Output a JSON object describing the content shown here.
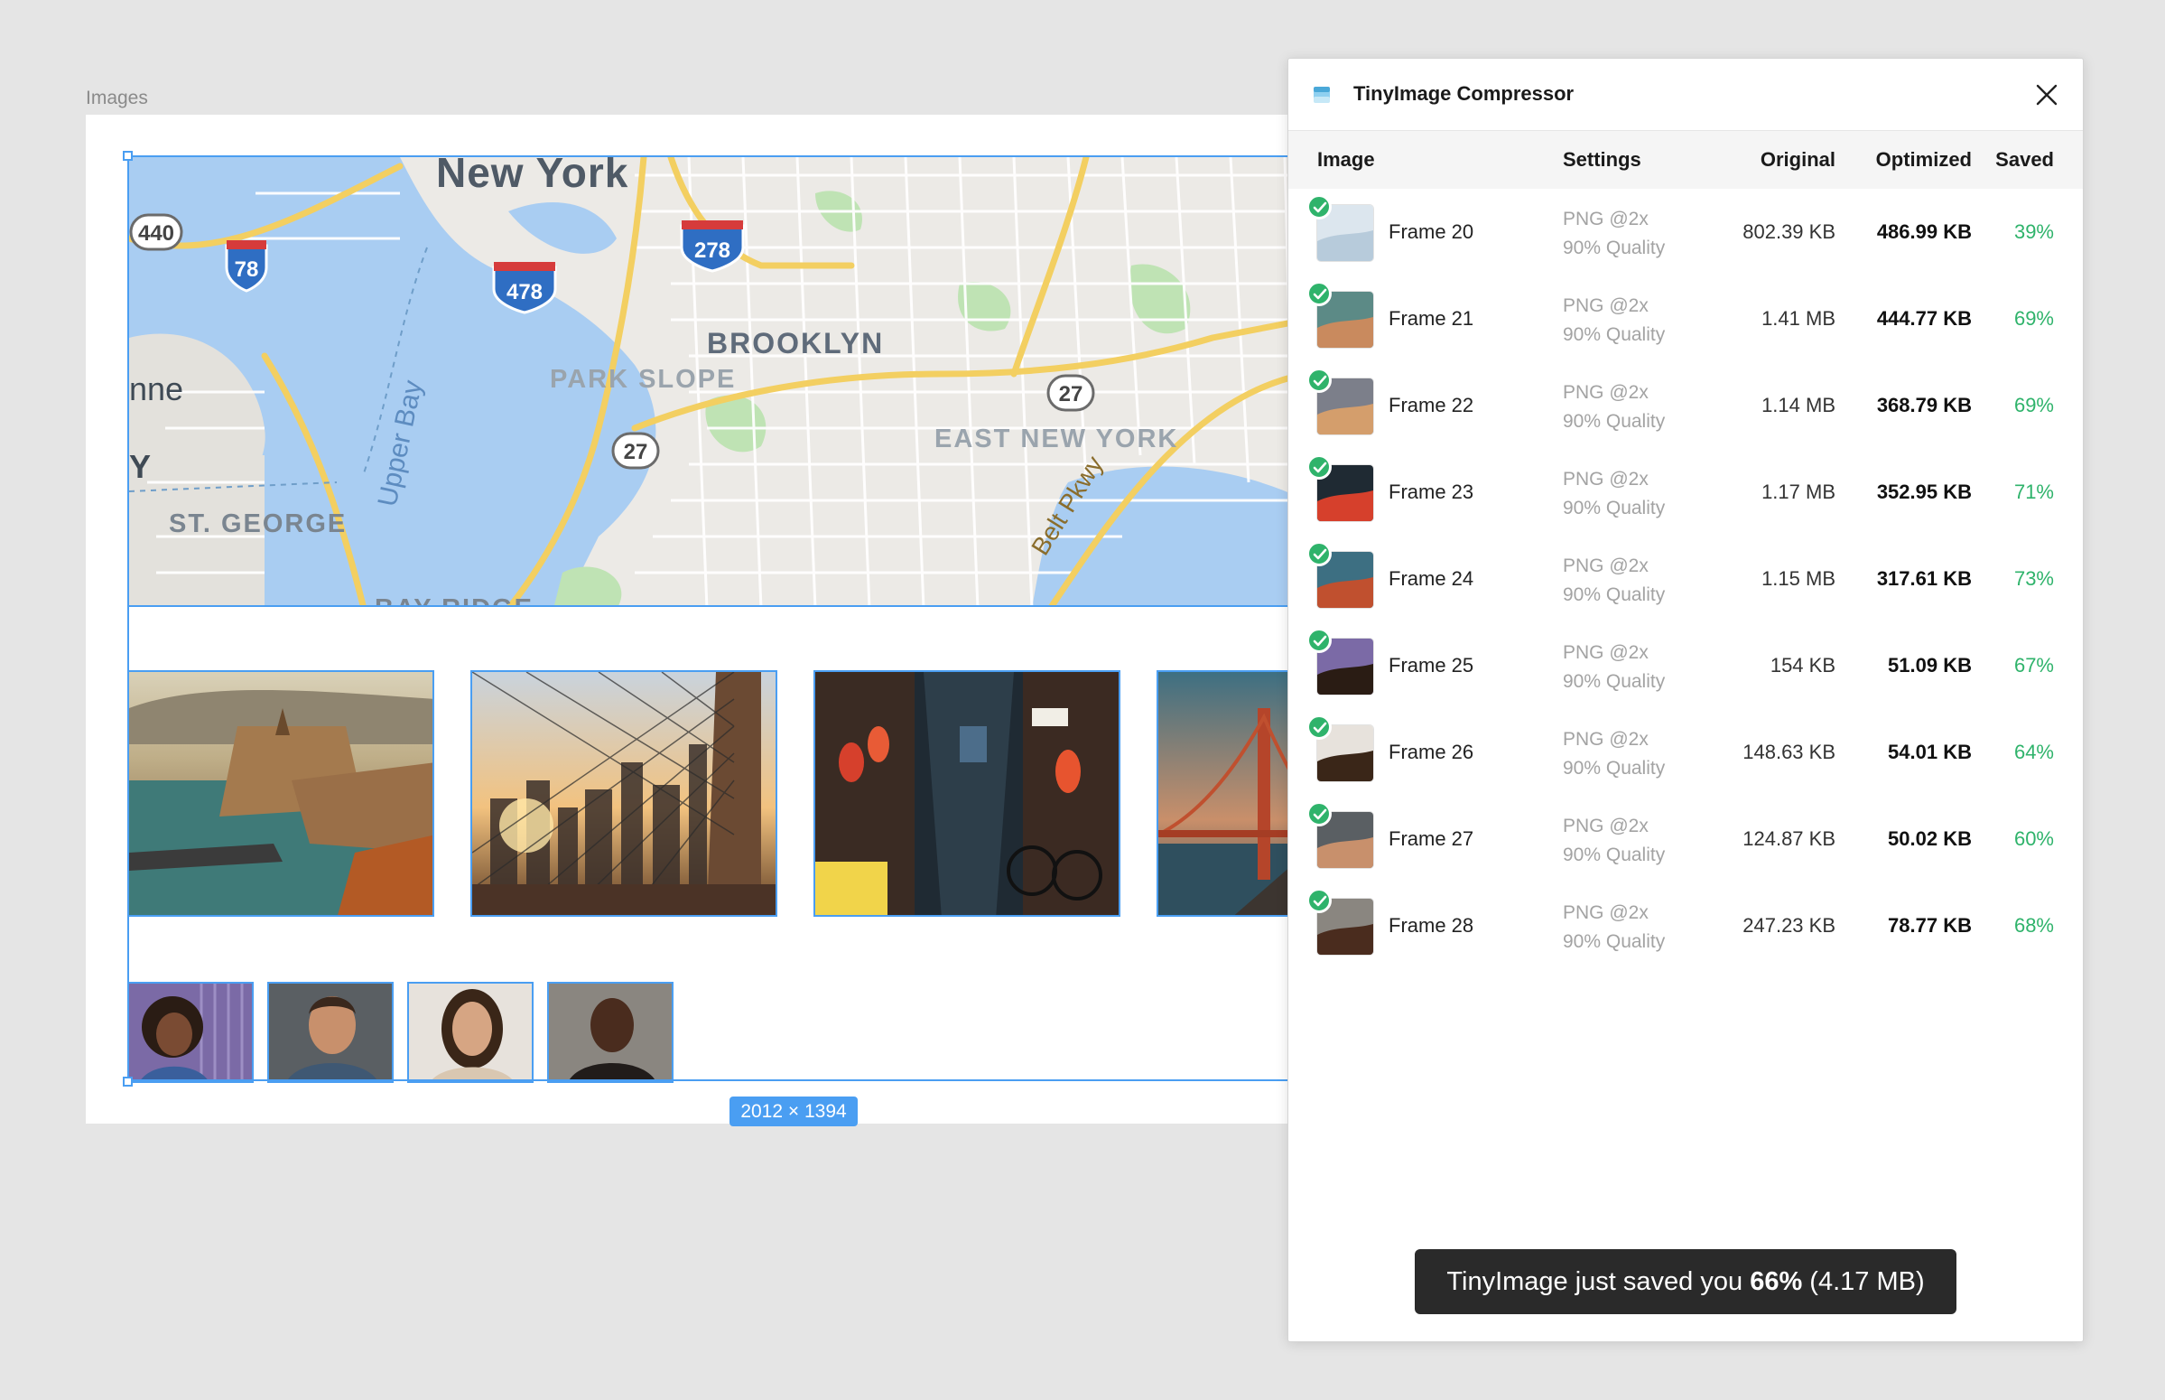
{
  "canvas": {
    "frame_label": "Images",
    "selection_size": "2012 × 1394",
    "map_labels": [
      "New York",
      "BROOKLYN",
      "PARK SLOPE",
      "EAST NEW YORK",
      "ST. GEORGE",
      "BAY RIDGE",
      "Upper Bay",
      "Belt Pkwy",
      "nne",
      "Y"
    ],
    "highway_shields": [
      "440",
      "78",
      "478",
      "278",
      "27",
      "27"
    ]
  },
  "panel": {
    "title": "TinyImage Compressor",
    "columns": {
      "image": "Image",
      "settings": "Settings",
      "original": "Original",
      "optimized": "Optimized",
      "saved": "Saved"
    },
    "rows": [
      {
        "name": "Frame 20",
        "format": "PNG @2x",
        "quality": "90% Quality",
        "original": "802.39 KB",
        "optimized": "486.99 KB",
        "saved": "39%"
      },
      {
        "name": "Frame 21",
        "format": "PNG @2x",
        "quality": "90% Quality",
        "original": "1.41 MB",
        "optimized": "444.77 KB",
        "saved": "69%"
      },
      {
        "name": "Frame 22",
        "format": "PNG @2x",
        "quality": "90% Quality",
        "original": "1.14 MB",
        "optimized": "368.79 KB",
        "saved": "69%"
      },
      {
        "name": "Frame 23",
        "format": "PNG @2x",
        "quality": "90% Quality",
        "original": "1.17 MB",
        "optimized": "352.95 KB",
        "saved": "71%"
      },
      {
        "name": "Frame 24",
        "format": "PNG @2x",
        "quality": "90% Quality",
        "original": "1.15 MB",
        "optimized": "317.61 KB",
        "saved": "73%"
      },
      {
        "name": "Frame 25",
        "format": "PNG @2x",
        "quality": "90% Quality",
        "original": "154 KB",
        "optimized": "51.09 KB",
        "saved": "67%"
      },
      {
        "name": "Frame 26",
        "format": "PNG @2x",
        "quality": "90% Quality",
        "original": "148.63 KB",
        "optimized": "54.01 KB",
        "saved": "64%"
      },
      {
        "name": "Frame 27",
        "format": "PNG @2x",
        "quality": "90% Quality",
        "original": "124.87 KB",
        "optimized": "50.02 KB",
        "saved": "60%"
      },
      {
        "name": "Frame 28",
        "format": "PNG @2x",
        "quality": "90% Quality",
        "original": "247.23 KB",
        "optimized": "78.77 KB",
        "saved": "68%"
      }
    ],
    "toast": {
      "prefix": "TinyImage just saved you",
      "percent": "66%",
      "amount": "(4.17 MB)"
    }
  },
  "colors": {
    "selection": "#4a9ef2",
    "success": "#2fb36b",
    "toast_bg": "#2a2a2a",
    "canvas_bg": "#e5e5e5"
  }
}
